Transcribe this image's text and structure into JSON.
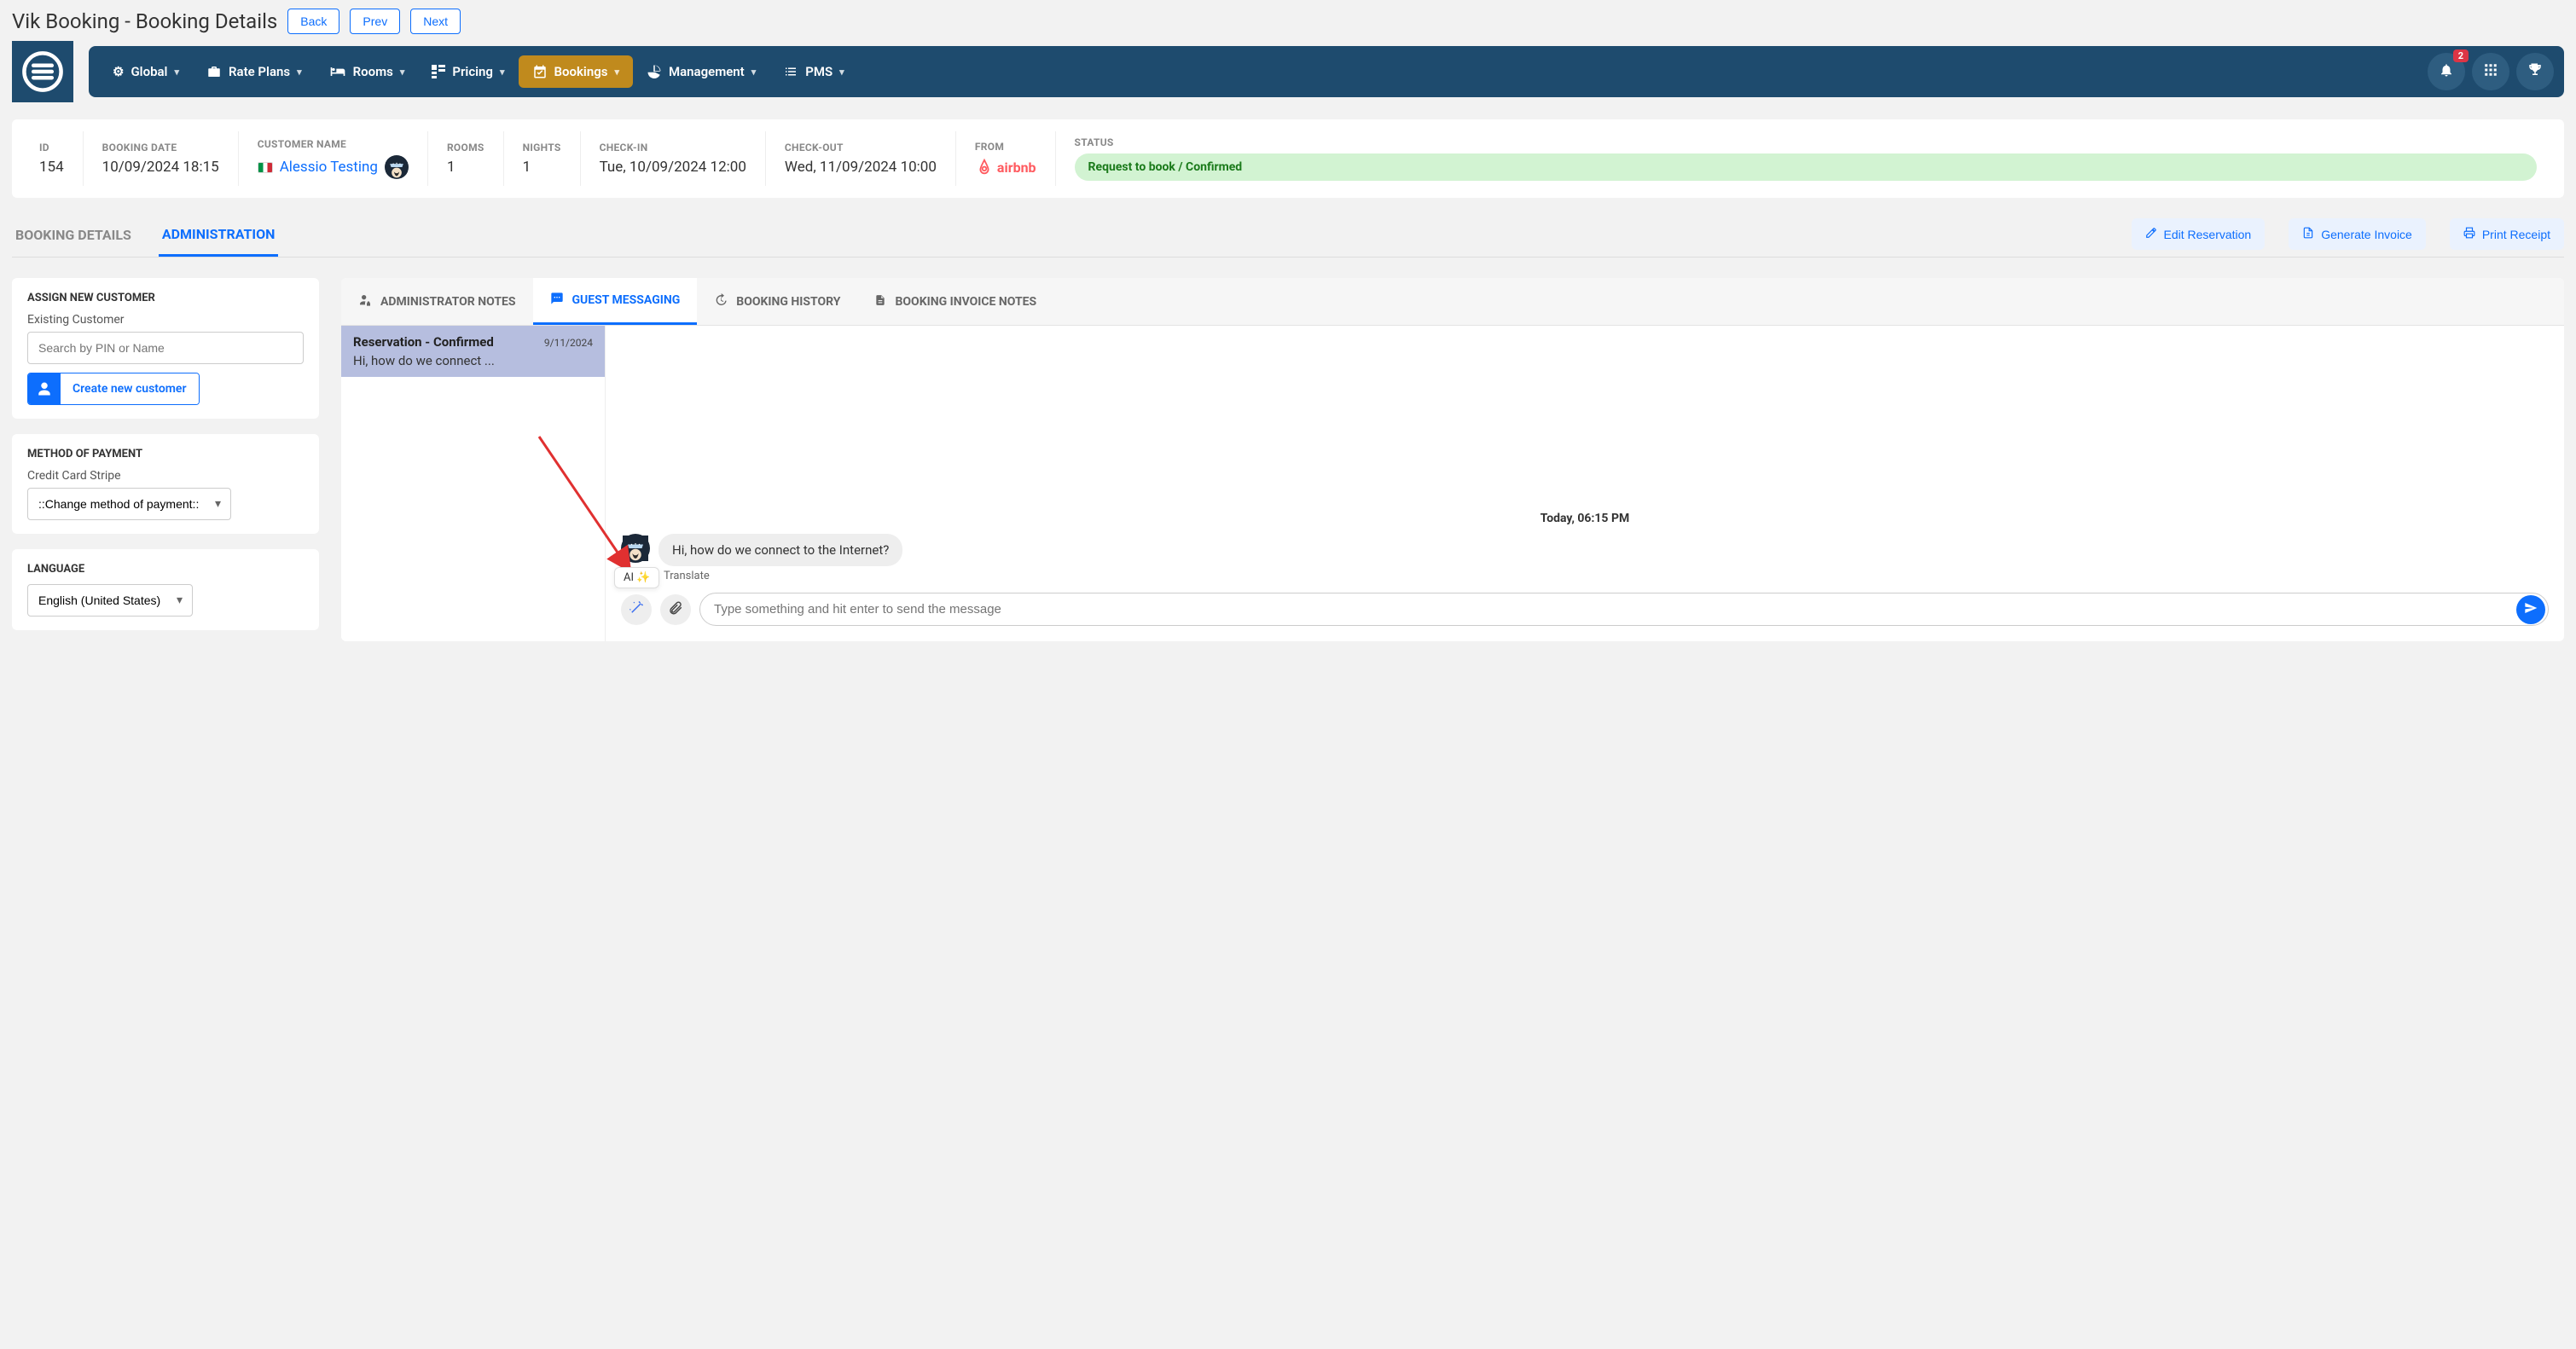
{
  "page": {
    "title": "Vik Booking - Booking Details"
  },
  "header_buttons": {
    "back": "Back",
    "prev": "Prev",
    "next": "Next"
  },
  "nav": {
    "items": [
      {
        "label": "Global"
      },
      {
        "label": "Rate Plans"
      },
      {
        "label": "Rooms"
      },
      {
        "label": "Pricing"
      },
      {
        "label": "Bookings"
      },
      {
        "label": "Management"
      },
      {
        "label": "PMS"
      }
    ],
    "badge_count": "2"
  },
  "summary": {
    "id_label": "ID",
    "id": "154",
    "booking_date_label": "BOOKING DATE",
    "booking_date": "10/09/2024 18:15",
    "customer_label": "CUSTOMER NAME",
    "customer_name": "Alessio Testing",
    "rooms_label": "ROOMS",
    "rooms": "1",
    "nights_label": "NIGHTS",
    "nights": "1",
    "checkin_label": "CHECK-IN",
    "checkin": "Tue, 10/09/2024 12:00",
    "checkout_label": "CHECK-OUT",
    "checkout": "Wed, 11/09/2024 10:00",
    "from_label": "FROM",
    "from_channel": "airbnb",
    "status_label": "STATUS",
    "status": "Request to book / Confirmed"
  },
  "tabs": {
    "details": "BOOKING DETAILS",
    "admin": "ADMINISTRATION"
  },
  "actions": {
    "edit": "Edit Reservation",
    "invoice": "Generate Invoice",
    "print": "Print Receipt"
  },
  "side": {
    "assign": {
      "title": "ASSIGN NEW CUSTOMER",
      "existing_label": "Existing Customer",
      "search_placeholder": "Search by PIN or Name",
      "create_label": "Create new customer"
    },
    "payment": {
      "title": "METHOD OF PAYMENT",
      "subtitle": "Credit Card Stripe",
      "select_value": "::Change method of payment::"
    },
    "language": {
      "title": "LANGUAGE",
      "select_value": "English (United States)"
    }
  },
  "inner_tabs": {
    "admin_notes": "ADMINISTRATOR NOTES",
    "guest_msg": "GUEST MESSAGING",
    "history": "BOOKING HISTORY",
    "invoice_notes": "BOOKING INVOICE NOTES"
  },
  "thread": {
    "title": "Reservation - Confirmed",
    "date": "9/11/2024",
    "preview": "Hi, how do we connect ..."
  },
  "chat": {
    "time_sep": "Today, 06:15 PM",
    "message": "Hi, how do we connect to the Internet?",
    "translate": "Translate",
    "ai_tooltip": "AI ✨",
    "composer_placeholder": "Type something and hit enter to send the message"
  }
}
